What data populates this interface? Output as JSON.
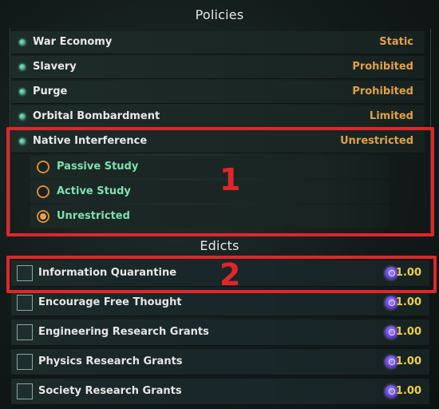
{
  "policies_title": "Policies",
  "edicts_title": "Edicts",
  "policies": [
    {
      "name": "War Economy",
      "status": "Static"
    },
    {
      "name": "Slavery",
      "status": "Prohibited"
    },
    {
      "name": "Purge",
      "status": "Prohibited"
    },
    {
      "name": "Orbital Bombardment",
      "status": "Limited"
    },
    {
      "name": "Native Interference",
      "status": "Unrestricted"
    }
  ],
  "native_interference_options": [
    {
      "label": "Passive Study",
      "selected": false
    },
    {
      "label": "Active Study",
      "selected": false
    },
    {
      "label": "Unrestricted",
      "selected": true
    }
  ],
  "edicts": [
    {
      "name": "Information Quarantine",
      "cost": "1.00"
    },
    {
      "name": "Encourage Free Thought",
      "cost": "1.00"
    },
    {
      "name": "Engineering Research Grants",
      "cost": "1.00"
    },
    {
      "name": "Physics Research Grants",
      "cost": "1.00"
    },
    {
      "name": "Society Research Grants",
      "cost": "1.00"
    }
  ],
  "annotations": [
    "1",
    "2"
  ],
  "colors": {
    "status_orange": "#e0a04a",
    "option_green": "#7fe0b0",
    "cost_yellow": "#f0d040",
    "highlight_red": "#e0262a",
    "influence_purple": "#6440d0"
  },
  "icons": {
    "policy_bullet": "policy-bullet-icon",
    "cost": "influence-icon",
    "checkbox": "checkbox"
  }
}
